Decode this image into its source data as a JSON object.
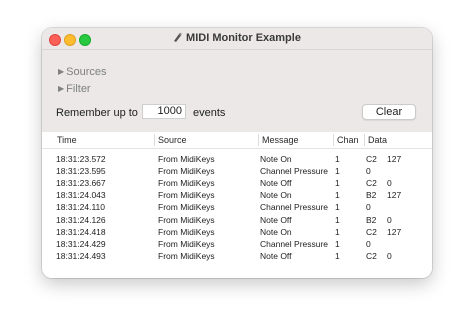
{
  "window": {
    "title": "MIDI Monitor Example"
  },
  "sources": {
    "label": "Sources"
  },
  "filter": {
    "label": "Filter"
  },
  "remember": {
    "prefix": "Remember up to",
    "value": "1000",
    "suffix": "events"
  },
  "clear": {
    "label": "Clear"
  },
  "table": {
    "columns": [
      "Time",
      "Source",
      "Message",
      "Chan",
      "Data"
    ],
    "rows": [
      {
        "time": "18:31:23.572",
        "source": "From MidiKeys",
        "message": "Note On",
        "chan": "1",
        "d1": "C2",
        "d2": "127"
      },
      {
        "time": "18:31:23.595",
        "source": "From MidiKeys",
        "message": "Channel Pressure",
        "chan": "1",
        "d1": "0",
        "d2": ""
      },
      {
        "time": "18:31:23.667",
        "source": "From MidiKeys",
        "message": "Note Off",
        "chan": "1",
        "d1": "C2",
        "d2": "0"
      },
      {
        "time": "18:31:24.043",
        "source": "From MidiKeys",
        "message": "Note On",
        "chan": "1",
        "d1": "B2",
        "d2": "127"
      },
      {
        "time": "18:31:24.110",
        "source": "From MidiKeys",
        "message": "Channel Pressure",
        "chan": "1",
        "d1": "0",
        "d2": ""
      },
      {
        "time": "18:31:24.126",
        "source": "From MidiKeys",
        "message": "Note Off",
        "chan": "1",
        "d1": "B2",
        "d2": "0"
      },
      {
        "time": "18:31:24.418",
        "source": "From MidiKeys",
        "message": "Note On",
        "chan": "1",
        "d1": "C2",
        "d2": "127"
      },
      {
        "time": "18:31:24.429",
        "source": "From MidiKeys",
        "message": "Channel Pressure",
        "chan": "1",
        "d1": "0",
        "d2": ""
      },
      {
        "time": "18:31:24.493",
        "source": "From MidiKeys",
        "message": "Note Off",
        "chan": "1",
        "d1": "C2",
        "d2": "0"
      }
    ]
  },
  "colors": {
    "close": "#fe5f57",
    "minimize": "#febc2e",
    "maximize": "#28c840",
    "panel": "#ebe8e7",
    "disclosure_text": "#808080"
  }
}
